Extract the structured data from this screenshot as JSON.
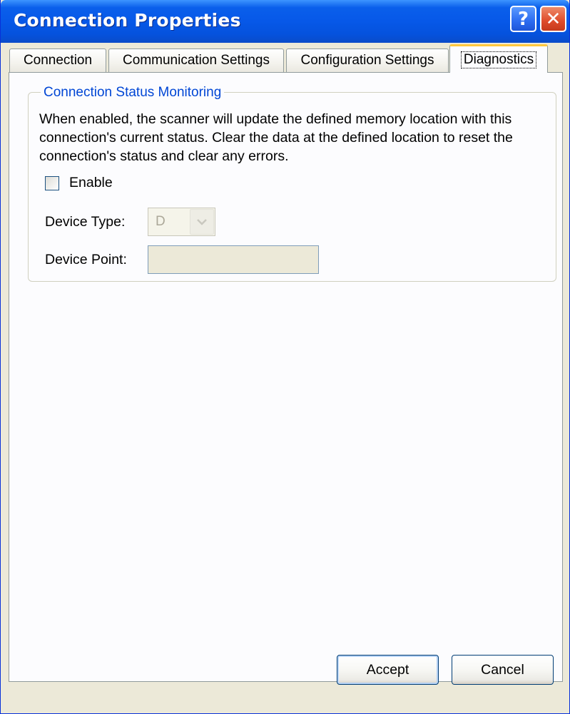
{
  "window": {
    "title": "Connection Properties"
  },
  "titlebar": {
    "help_label": "?",
    "close_label": "✕"
  },
  "tabs": [
    {
      "label": "Connection",
      "active": false
    },
    {
      "label": "Communication Settings",
      "active": false
    },
    {
      "label": "Configuration Settings",
      "active": false
    },
    {
      "label": "Diagnostics",
      "active": true
    }
  ],
  "group": {
    "title": "Connection Status Monitoring",
    "description": "When enabled, the scanner will update the defined memory location with this connection's current status. Clear the data at the defined location to reset the connection's status and clear any errors.",
    "enable": {
      "label": "Enable",
      "checked": false
    },
    "device_type": {
      "label": "Device Type:",
      "value": "D",
      "enabled": false
    },
    "device_point": {
      "label": "Device Point:",
      "value": "",
      "enabled": false
    }
  },
  "buttons": {
    "accept": "Accept",
    "cancel": "Cancel"
  }
}
